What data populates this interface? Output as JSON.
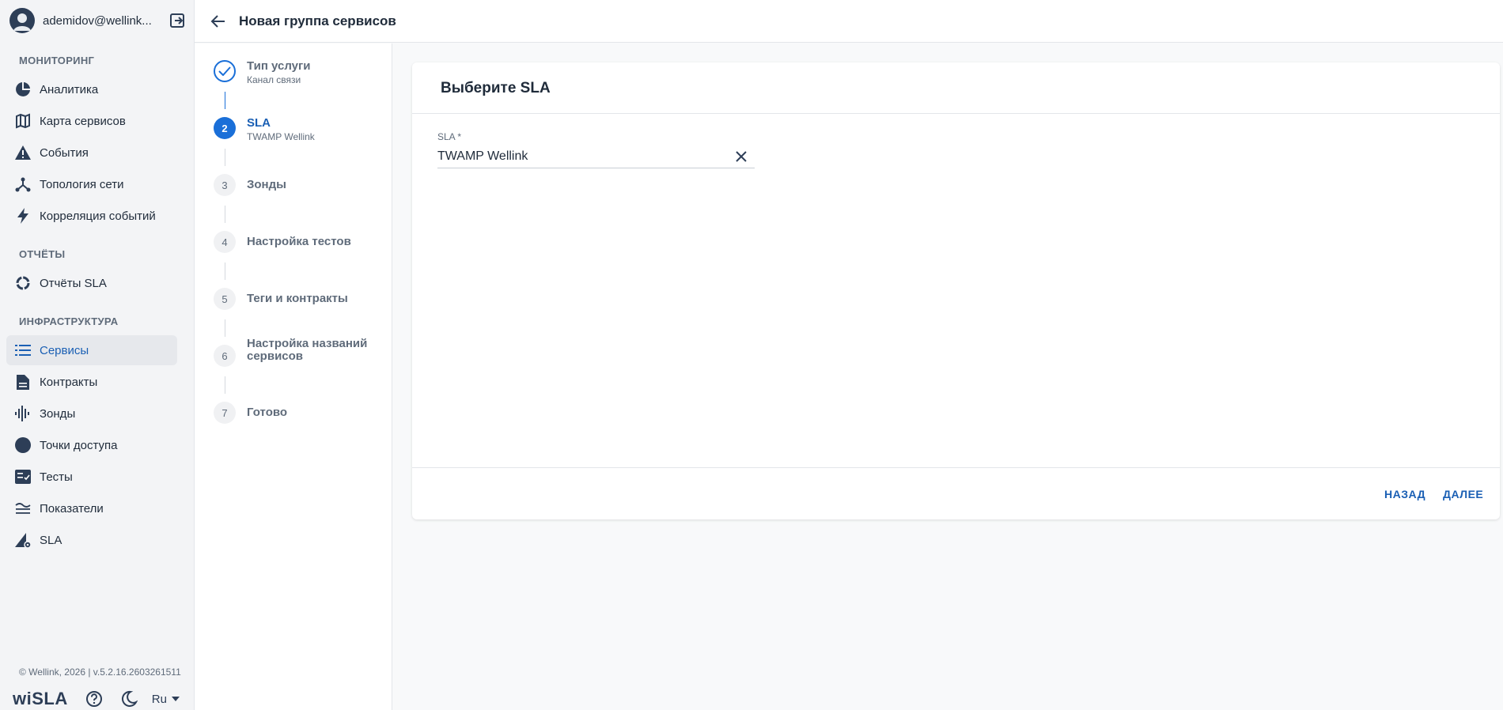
{
  "user": {
    "name": "ademidov@wellink..."
  },
  "sections": {
    "monitoring": "МОНИТОРИНГ",
    "reports": "ОТЧЁТЫ",
    "infrastructure": "ИНФРАСТРУКТУРА"
  },
  "nav": {
    "analytics": "Аналитика",
    "service_map": "Карта сервисов",
    "events": "События",
    "topology": "Топология сети",
    "correlation": "Корреляция событий",
    "sla_reports": "Отчёты SLA",
    "services": "Сервисы",
    "contracts": "Контракты",
    "probes": "Зонды",
    "access_points": "Точки доступа",
    "tests": "Тесты",
    "metrics": "Показатели",
    "sla": "SLA"
  },
  "footer": {
    "copyright": "© Wellink, 2026 | v.5.2.16.2603261511",
    "logo": "wiSLA",
    "language": "Ru"
  },
  "header": {
    "title": "Новая группа сервисов"
  },
  "stepper": {
    "steps": [
      {
        "title": "Тип услуги",
        "subtitle": "Канал связи",
        "num": "1"
      },
      {
        "title": "SLA",
        "subtitle": "TWAMP Wellink",
        "num": "2"
      },
      {
        "title": "Зонды",
        "num": "3"
      },
      {
        "title": "Настройка тестов",
        "num": "4"
      },
      {
        "title": "Теги и контракты",
        "num": "5"
      },
      {
        "title": "Настройка названий сервисов",
        "num": "6"
      },
      {
        "title": "Готово",
        "num": "7"
      }
    ]
  },
  "card": {
    "title": "Выберите SLA",
    "field_label": "SLA *",
    "field_value": "TWAMP Wellink",
    "back_label": "НАЗАД",
    "next_label": "ДАЛЕЕ"
  },
  "colors": {
    "accent": "#1a6fd8",
    "text": "#1f2b3a",
    "muted": "#5f6b7a"
  }
}
